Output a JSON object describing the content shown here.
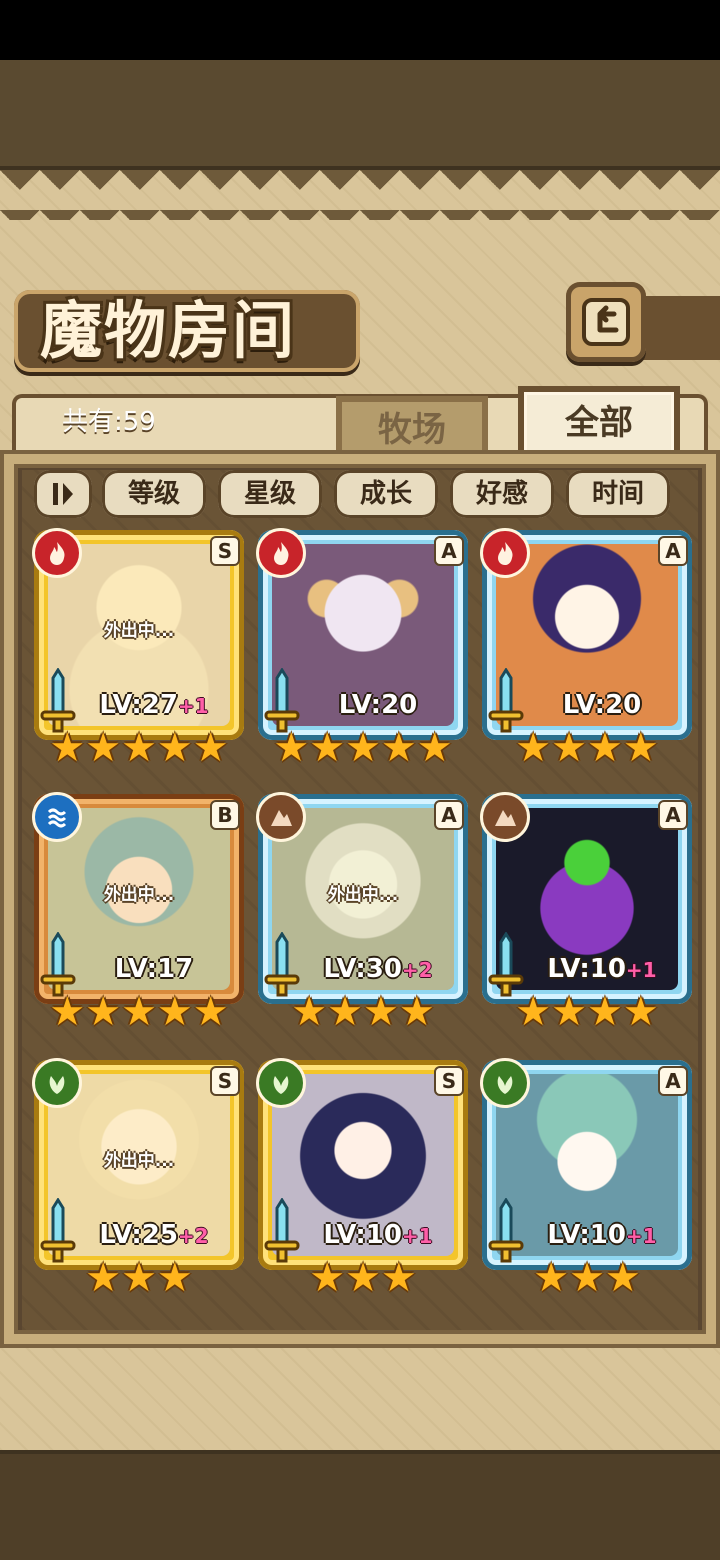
{
  "screen": {
    "title": "魔物房间",
    "count_label": "共有:59"
  },
  "tabs": [
    {
      "label": "牧场",
      "active": false
    },
    {
      "label": "全部",
      "active": true
    }
  ],
  "sort_buttons": [
    "等级",
    "星级",
    "成长",
    "好感",
    "时间"
  ],
  "away_label": "外出中...",
  "cards": [
    {
      "element": "fire",
      "element_icon": "flame-icon",
      "rank": "S",
      "frame_color": "#f3c52a",
      "level": "LV:27",
      "bonus": "+1",
      "stars": 5,
      "away": true
    },
    {
      "element": "fire",
      "element_icon": "flame-icon",
      "rank": "A",
      "frame_color": "#8fd6f0",
      "level": "LV:20",
      "bonus": "",
      "stars": 5,
      "away": false
    },
    {
      "element": "fire",
      "element_icon": "flame-icon",
      "rank": "A",
      "frame_color": "#8fd6f0",
      "level": "LV:20",
      "bonus": "",
      "stars": 4,
      "away": false
    },
    {
      "element": "water",
      "element_icon": "waves-icon",
      "rank": "B",
      "frame_color": "#d88a3c",
      "level": "LV:17",
      "bonus": "",
      "stars": 5,
      "away": true
    },
    {
      "element": "earth",
      "element_icon": "rock-icon",
      "rank": "A",
      "frame_color": "#8fd6f0",
      "level": "LV:30",
      "bonus": "+2",
      "stars": 4,
      "away": true
    },
    {
      "element": "earth",
      "element_icon": "rock-icon",
      "rank": "A",
      "frame_color": "#8fd6f0",
      "level": "LV:10",
      "bonus": "+1",
      "stars": 4,
      "away": false
    },
    {
      "element": "nature",
      "element_icon": "leaf-icon",
      "rank": "S",
      "frame_color": "#f3c52a",
      "level": "LV:25",
      "bonus": "+2",
      "stars": 3,
      "away": true
    },
    {
      "element": "nature",
      "element_icon": "leaf-icon",
      "rank": "S",
      "frame_color": "#f3c52a",
      "level": "LV:10",
      "bonus": "+1",
      "stars": 3,
      "away": false
    },
    {
      "element": "nature",
      "element_icon": "leaf-icon",
      "rank": "A",
      "frame_color": "#8fd6f0",
      "level": "LV:10",
      "bonus": "+1",
      "stars": 3,
      "away": false
    }
  ]
}
